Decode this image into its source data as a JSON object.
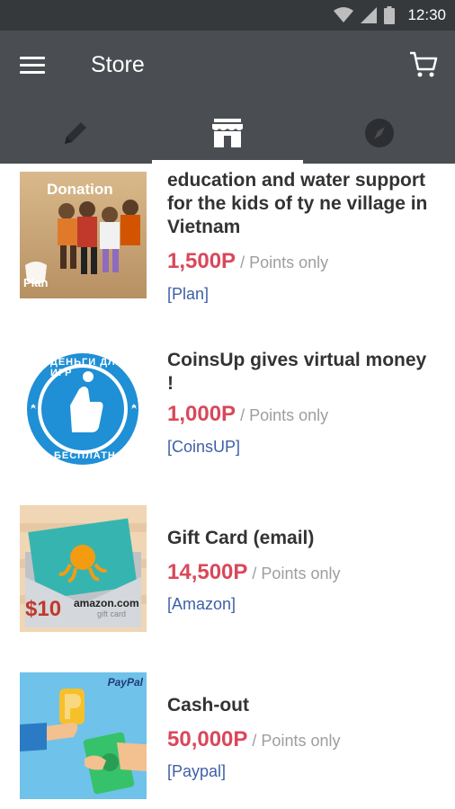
{
  "status_bar": {
    "time": "12:30",
    "icons": [
      "wifi-icon",
      "cell-signal-icon",
      "battery-icon"
    ]
  },
  "app_bar": {
    "title": "Store",
    "menu_icon": "hamburger-icon",
    "cart_icon": "cart-icon"
  },
  "tabs": [
    {
      "icon": "pencil-icon",
      "selected": false
    },
    {
      "icon": "store-icon",
      "selected": true
    },
    {
      "icon": "compass-icon",
      "selected": false
    }
  ],
  "colors": {
    "app_bar": "#4a4d51",
    "status_bar": "#36393c",
    "price": "#d9485a",
    "vendor": "#3e5fa8",
    "title": "#333333"
  },
  "items": [
    {
      "title": "education and water support for the kids of ty ne village in Vietnam",
      "price": "1,500P",
      "price_suffix": " / Points only",
      "vendor": "[Plan]",
      "thumb_label": "Donation",
      "thumb_logo": "Plan"
    },
    {
      "title": "CoinsUp gives virtual money !",
      "price": "1,000P",
      "price_suffix": " / Points only",
      "vendor": "[CoinsUP]",
      "thumb_top": "ДЕНЬГИ ДЛЯ ИГР",
      "thumb_bottom": "БЕСПЛАТНО!"
    },
    {
      "title": "Gift Card (email)",
      "price": "14,500P",
      "price_suffix": " / Points only",
      "vendor": "[Amazon]",
      "thumb_amount": "$10",
      "thumb_brand": "amazon.com",
      "thumb_sub": "gift card"
    },
    {
      "title": "Cash-out",
      "price": "50,000P",
      "price_suffix": " / Points only",
      "vendor": "[Paypal]",
      "thumb_brand": "PayPal"
    }
  ]
}
